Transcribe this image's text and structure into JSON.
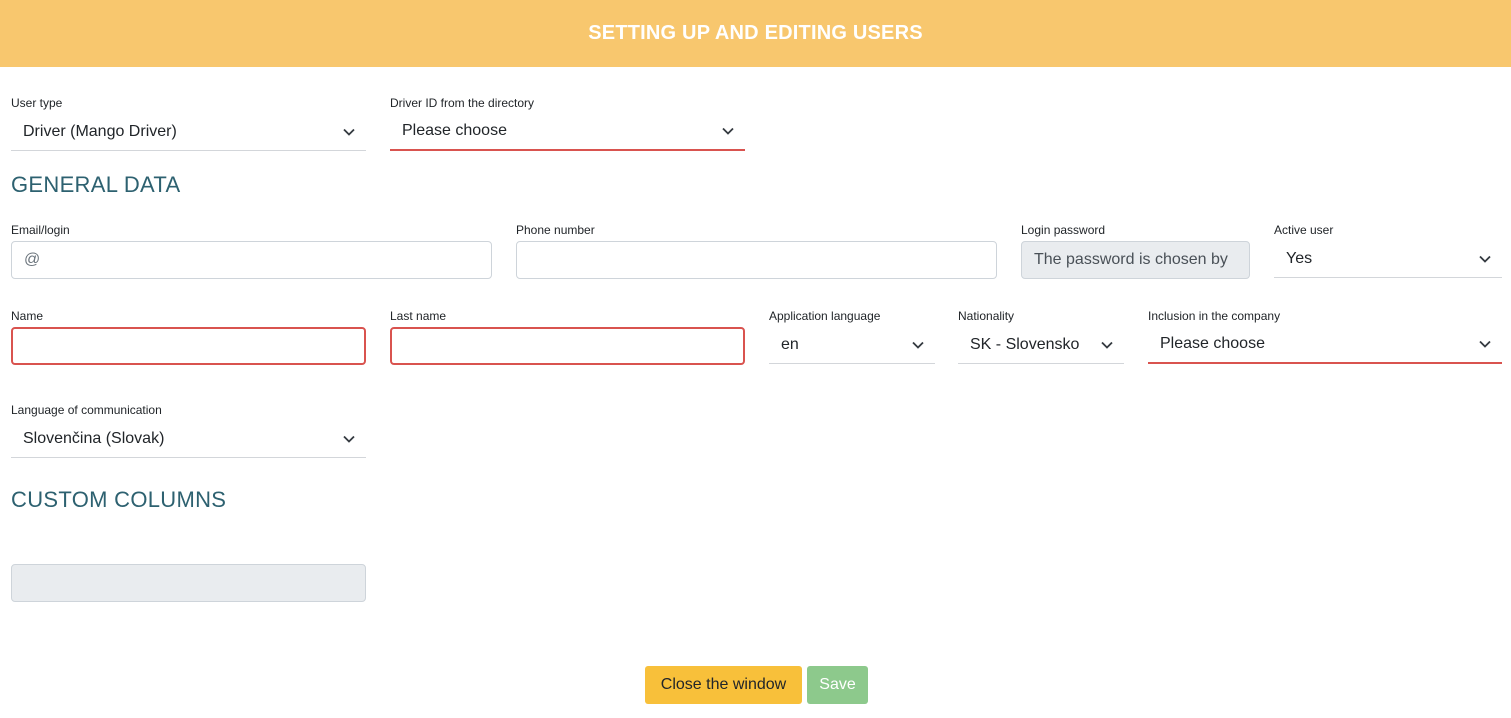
{
  "header": {
    "title": "SETTING UP AND EDITING USERS"
  },
  "top": {
    "user_type": {
      "label": "User type",
      "value": "Driver (Mango Driver)"
    },
    "driver_id": {
      "label": "Driver ID from the directory",
      "value": "Please choose"
    }
  },
  "sections": {
    "general": "GENERAL DATA",
    "custom": "CUSTOM COLUMNS"
  },
  "general": {
    "email": {
      "label": "Email/login",
      "placeholder": "@"
    },
    "phone": {
      "label": "Phone number",
      "value": ""
    },
    "password": {
      "label": "Login password",
      "value": "The password is chosen by"
    },
    "active": {
      "label": "Active user",
      "value": "Yes"
    },
    "name": {
      "label": "Name",
      "value": ""
    },
    "last_name": {
      "label": "Last name",
      "value": ""
    },
    "app_language": {
      "label": "Application language",
      "value": "en"
    },
    "nationality": {
      "label": "Nationality",
      "value": "SK - Slovensko"
    },
    "company": {
      "label": "Inclusion in the company",
      "value": "Please choose"
    },
    "comm_language": {
      "label": "Language of communication",
      "value": "Slovenčina (Slovak)"
    }
  },
  "custom": {
    "field_value": ""
  },
  "buttons": {
    "close": "Close the window",
    "save": "Save"
  },
  "colors": {
    "header": "#f8c76e",
    "section": "#2d6170",
    "invalid": "#d9534f",
    "close_button": "#f8c03a",
    "save_button": "#8dc98c"
  },
  "icons": {
    "dropdown": "chevron-down-icon"
  }
}
